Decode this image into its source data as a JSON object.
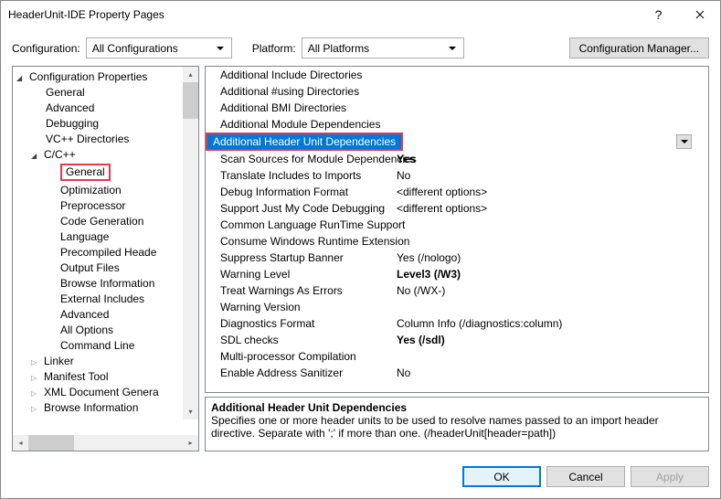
{
  "window": {
    "title": "HeaderUnit-IDE Property Pages"
  },
  "config": {
    "cfg_label": "Configuration:",
    "cfg_value": "All Configurations",
    "plat_label": "Platform:",
    "plat_value": "All Platforms",
    "mgr_button": "Configuration Manager..."
  },
  "tree": {
    "root": "Configuration Properties",
    "general": "General",
    "advanced": "Advanced",
    "debugging": "Debugging",
    "vcdirs": "VC++ Directories",
    "ccpp": "C/C++",
    "ccpp_general": "General",
    "ccpp_optimization": "Optimization",
    "ccpp_preprocessor": "Preprocessor",
    "ccpp_codegen": "Code Generation",
    "ccpp_language": "Language",
    "ccpp_pch": "Precompiled Heade",
    "ccpp_output": "Output Files",
    "ccpp_browse": "Browse Information",
    "ccpp_extincl": "External Includes",
    "ccpp_advanced": "Advanced",
    "ccpp_allopts": "All Options",
    "ccpp_cmdline": "Command Line",
    "linker": "Linker",
    "manifest": "Manifest Tool",
    "xmldoc": "XML Document Genera",
    "browseinfo": "Browse Information"
  },
  "props": {
    "r0": {
      "label": "Additional Include Directories"
    },
    "r1": {
      "label": "Additional #using Directories"
    },
    "r2": {
      "label": "Additional BMI Directories"
    },
    "r3": {
      "label": "Additional Module Dependencies"
    },
    "r4": {
      "label": "Additional Header Unit Dependencies"
    },
    "r5": {
      "label": "Scan Sources for Module Dependencies",
      "value": "Yes"
    },
    "r6": {
      "label": "Translate Includes to Imports",
      "value": "No"
    },
    "r7": {
      "label": "Debug Information Format",
      "value": "<different options>"
    },
    "r8": {
      "label": "Support Just My Code Debugging",
      "value": "<different options>"
    },
    "r9": {
      "label": "Common Language RunTime Support"
    },
    "r10": {
      "label": "Consume Windows Runtime Extension"
    },
    "r11": {
      "label": "Suppress Startup Banner",
      "value": "Yes (/nologo)"
    },
    "r12": {
      "label": "Warning Level",
      "value": "Level3 (/W3)"
    },
    "r13": {
      "label": "Treat Warnings As Errors",
      "value": "No (/WX-)"
    },
    "r14": {
      "label": "Warning Version"
    },
    "r15": {
      "label": "Diagnostics Format",
      "value": "Column Info (/diagnostics:column)"
    },
    "r16": {
      "label": "SDL checks",
      "value": "Yes (/sdl)"
    },
    "r17": {
      "label": "Multi-processor Compilation"
    },
    "r18": {
      "label": "Enable Address Sanitizer",
      "value": "No"
    }
  },
  "desc": {
    "title": "Additional Header Unit Dependencies",
    "text": "Specifies one or more header units to be used to resolve names passed to an import header directive. Separate with ';' if more than one.   (/headerUnit[header=path])"
  },
  "footer": {
    "ok": "OK",
    "cancel": "Cancel",
    "apply": "Apply"
  }
}
